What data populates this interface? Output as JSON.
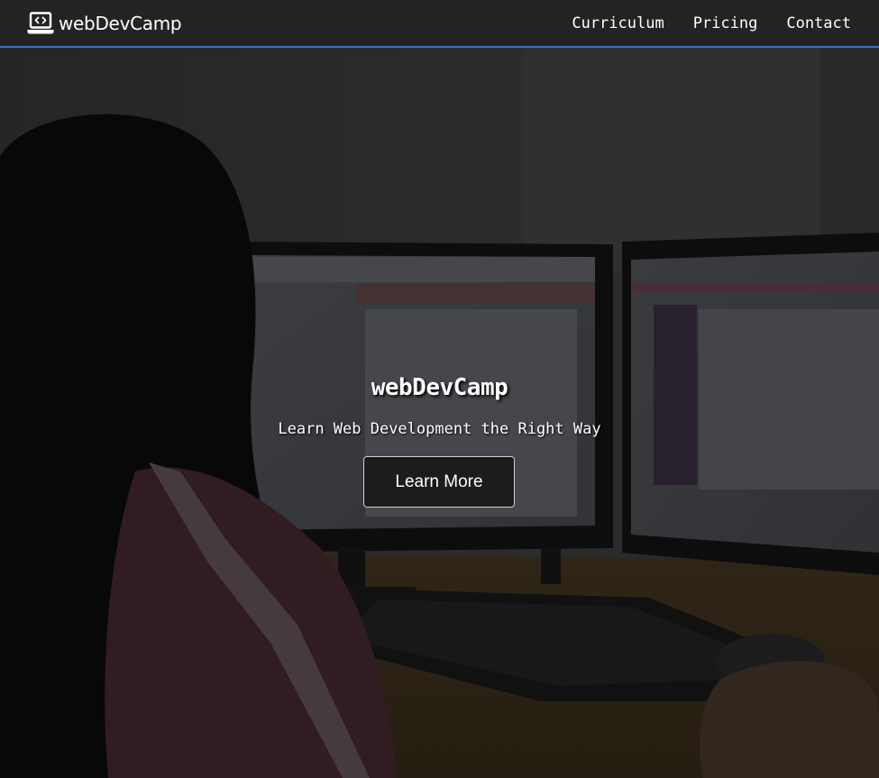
{
  "navbar": {
    "brand": {
      "icon": "laptop-code-icon",
      "label": "webDevCamp"
    },
    "links": [
      {
        "label": "Curriculum"
      },
      {
        "label": "Pricing"
      },
      {
        "label": "Contact"
      }
    ],
    "colors": {
      "background": "#232323",
      "accent_border": "#3b6fc9"
    }
  },
  "hero": {
    "background_image": "woman-at-desk-with-dual-monitors-photo",
    "title": "webDevCamp",
    "subtitle": "Learn Web Development the Right Way",
    "cta_label": "Learn More"
  }
}
